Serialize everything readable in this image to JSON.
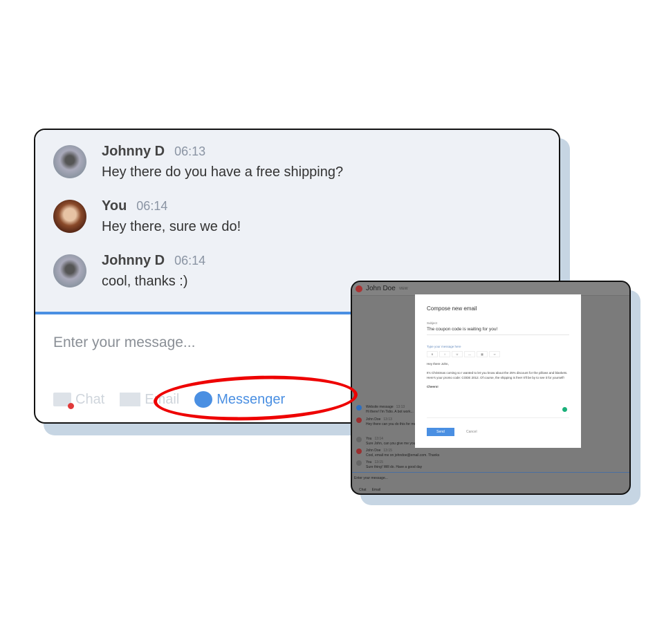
{
  "chat": {
    "messages": [
      {
        "author": "Johnny D",
        "time": "06:13",
        "text": "Hey there do you have a free shipping?",
        "avatar": "johnny"
      },
      {
        "author": "You",
        "time": "06:14",
        "text": "Hey there, sure we do!",
        "avatar": "you"
      },
      {
        "author": "Johnny D",
        "time": "06:14",
        "text": "cool, thanks :)",
        "avatar": "johnny"
      }
    ],
    "input_placeholder": "Enter your message...",
    "tabs": [
      {
        "label": "Chat",
        "icon": "chat-icon"
      },
      {
        "label": "Email",
        "icon": "mail-icon"
      },
      {
        "label": "Messenger",
        "icon": "messenger-icon",
        "active": true
      }
    ],
    "accent": "#4a8fe2",
    "highlight_color": "#ee0000"
  },
  "email_window": {
    "contact": "John Doe",
    "header_tag": "VIEW",
    "background_messages": [
      {
        "author": "Website message",
        "time": "13:13",
        "text": "Hi there! I'm Tidio. A bot work..."
      },
      {
        "author": "John Doe",
        "time": "13:13",
        "text": "Hey there can you do this for me?"
      },
      {
        "author": "You",
        "time": "13:14",
        "text": "Sure John, can you give me your email?"
      },
      {
        "author": "John Doe",
        "time": "13:15",
        "text": "Cool, email me on johndoe@email.com. Thanks"
      },
      {
        "author": "You",
        "time": "13:15",
        "text": "Sure thing! Will do. Have a good day"
      }
    ],
    "input_placeholder": "Enter your message...",
    "tabs": [
      "Chat",
      "Email"
    ],
    "modal": {
      "title": "Compose new email",
      "subject_label": "Subject",
      "subject": "The coupon code is waiting for you!",
      "message_label": "Type your message here",
      "toolbar": [
        "B",
        "I",
        "U",
        "—",
        "▦",
        "∞"
      ],
      "greeting": "Hey there John,",
      "body": "It's Christmas coming so I wanted to let you know about the 25% discount for the pillows and blankets. Here's your promo code: CODE 2012. Of course, the shipping is free! It'll be by to see it for yourself!",
      "signoff": "Cheers!",
      "send": "Send",
      "cancel": "Cancel"
    }
  }
}
